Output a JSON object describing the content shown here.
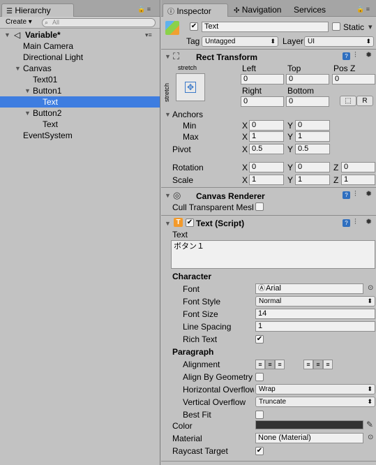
{
  "hierarchy": {
    "tab": "Hierarchy",
    "create": "Create",
    "search_placeholder": "All",
    "scene": "Variable*",
    "items": [
      "Main Camera",
      "Directional Light",
      "Canvas",
      "Text01",
      "Button1",
      "Text",
      "Button2",
      "Text",
      "EventSystem"
    ]
  },
  "inspector": {
    "tabs": [
      "Inspector",
      "Navigation",
      "Services"
    ],
    "object_name": "Text",
    "static_label": "Static",
    "tag_label": "Tag",
    "tag_value": "Untagged",
    "layer_label": "Layer",
    "layer_value": "UI",
    "rect": {
      "title": "Rect Transform",
      "stretch_top": "stretch",
      "stretch_side": "stretch",
      "left_label": "Left",
      "top_label": "Top",
      "posz_label": "Pos Z",
      "left": "0",
      "top": "0",
      "posz": "0",
      "right_label": "Right",
      "bottom_label": "Bottom",
      "right": "0",
      "bottom": "0",
      "r_button": "R",
      "anchors": "Anchors",
      "min": "Min",
      "max": "Max",
      "pivot": "Pivot",
      "min_x": "0",
      "min_y": "0",
      "max_x": "1",
      "max_y": "1",
      "pivot_x": "0.5",
      "pivot_y": "0.5",
      "rotation": "Rotation",
      "scale": "Scale",
      "rot_x": "0",
      "rot_y": "0",
      "rot_z": "0",
      "scale_x": "1",
      "scale_y": "1",
      "scale_z": "1",
      "x": "X",
      "y": "Y",
      "z": "Z"
    },
    "canvas_renderer": {
      "title": "Canvas Renderer",
      "cull": "Cull Transparent Mesh"
    },
    "text_script": {
      "title": "Text (Script)",
      "text_label": "Text",
      "text_value": "ボタン１",
      "character": "Character",
      "font": "Font",
      "font_value": "Arial",
      "font_style": "Font Style",
      "font_style_value": "Normal",
      "font_size": "Font Size",
      "font_size_value": "14",
      "line_spacing": "Line Spacing",
      "line_spacing_value": "1",
      "rich_text": "Rich Text",
      "paragraph": "Paragraph",
      "alignment": "Alignment",
      "align_geom": "Align By Geometry",
      "h_overflow": "Horizontal Overflow",
      "h_overflow_value": "Wrap",
      "v_overflow": "Vertical Overflow",
      "v_overflow_value": "Truncate",
      "best_fit": "Best Fit",
      "color": "Color",
      "material": "Material",
      "material_value": "None (Material)",
      "raycast": "Raycast Target"
    }
  }
}
